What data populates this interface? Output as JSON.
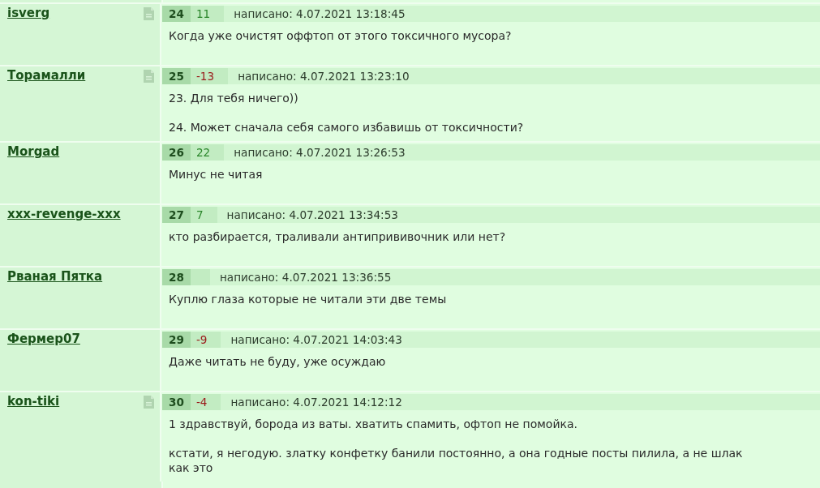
{
  "posts": [
    {
      "author": "isverg",
      "doc_icon": true,
      "number": "24",
      "score": {
        "text": "11",
        "kind": "positive"
      },
      "posted": "написано: 4.07.2021 13:18:45",
      "paragraphs": [
        "Когда уже очистят оффтоп от этого токсичного мусора?"
      ]
    },
    {
      "author": "Торамалли",
      "doc_icon": true,
      "number": "25",
      "score": {
        "text": "-13",
        "kind": "negative"
      },
      "posted": "написано: 4.07.2021 13:23:10",
      "paragraphs": [
        "23. Для тебя ничего))",
        "24. Может сначала себя самого избавишь от токсичности?"
      ]
    },
    {
      "author": "Morgad",
      "doc_icon": false,
      "number": "26",
      "score": {
        "text": "22",
        "kind": "positive"
      },
      "posted": "написано: 4.07.2021 13:26:53",
      "paragraphs": [
        "Минус не читая"
      ]
    },
    {
      "author": "xxx-revenge-xxx",
      "doc_icon": false,
      "number": "27",
      "score": {
        "text": "7",
        "kind": "positive"
      },
      "posted": "написано: 4.07.2021 13:34:53",
      "paragraphs": [
        "кто разбирается, траливали антипрививочник или нет?"
      ]
    },
    {
      "author": "Рваная Пятка",
      "doc_icon": false,
      "number": "28",
      "posted": "написано: 4.07.2021 13:36:55",
      "paragraphs": [
        "Куплю глаза которые не читали эти две темы"
      ]
    },
    {
      "author": "Фермер07",
      "doc_icon": false,
      "number": "29",
      "score": {
        "text": "-9",
        "kind": "negative"
      },
      "posted": "написано: 4.07.2021 14:03:43",
      "paragraphs": [
        "Даже читать не буду, уже осуждаю"
      ]
    },
    {
      "author": "kon-tiki",
      "doc_icon": true,
      "number": "30",
      "score": {
        "text": "-4",
        "kind": "negative"
      },
      "posted": "написано: 4.07.2021 14:12:12",
      "paragraphs": [
        "1 здравствуй, борода из ваты. хватить спамить, офтоп не помойка.",
        "кстати, я негодую. златку конфетку банили постоянно, а она годные посты пилила, а не шлак как это"
      ]
    }
  ]
}
